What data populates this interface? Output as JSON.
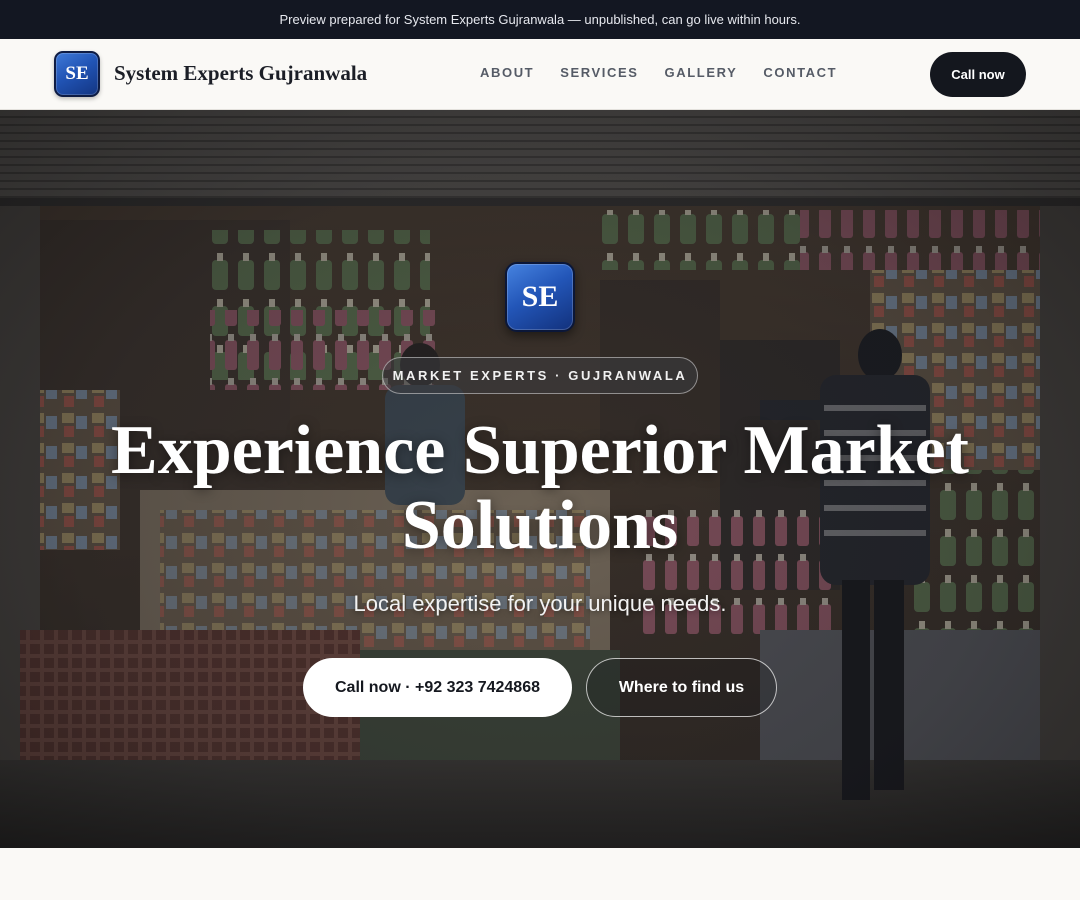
{
  "preview_bar": {
    "text": "Preview prepared for System Experts Gujranwala — unpublished, can go live within hours."
  },
  "nav": {
    "logo_initials": "SE",
    "brand": "System Experts Gujranwala",
    "links": [
      {
        "label": "ABOUT"
      },
      {
        "label": "SERVICES"
      },
      {
        "label": "GALLERY"
      },
      {
        "label": "CONTACT"
      }
    ],
    "cta_label": "Call now"
  },
  "hero": {
    "background_image": "market-shop-photo",
    "logo_initials": "SE",
    "eyebrow": "MARKET EXPERTS · GUJRANWALA",
    "title": "Experience Superior Market Solutions",
    "subtitle": "Local expertise for your unique needs.",
    "primary_cta": "Call now · +92 323 7424868",
    "secondary_cta": "Where to find us"
  },
  "colors": {
    "dark": "#14171e",
    "logo_blue": "#2356b8",
    "page_bg": "#faf9f6"
  }
}
